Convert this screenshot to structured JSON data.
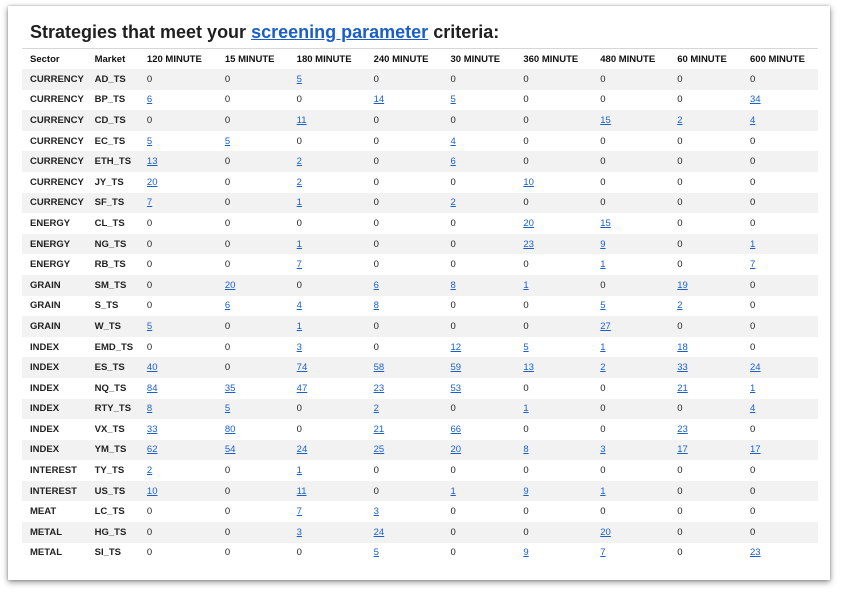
{
  "title": {
    "prefix": "Strategies that meet your",
    "link": "screening parameter",
    "suffix": "criteria:"
  },
  "columns": [
    "Sector",
    "Market",
    "120 MINUTE",
    "15 MINUTE",
    "180 MINUTE",
    "240 MINUTE",
    "30 MINUTE",
    "360 MINUTE",
    "480 MINUTE",
    "60 MINUTE",
    "600 MINUTE"
  ],
  "rows": [
    {
      "sector": "CURRENCY",
      "market": "AD_TS",
      "values": [
        "0",
        "0",
        "5",
        "0",
        "0",
        "0",
        "0",
        "0",
        "0"
      ]
    },
    {
      "sector": "CURRENCY",
      "market": "BP_TS",
      "values": [
        "6",
        "0",
        "0",
        "14",
        "5",
        "0",
        "0",
        "0",
        "34"
      ]
    },
    {
      "sector": "CURRENCY",
      "market": "CD_TS",
      "values": [
        "0",
        "0",
        "11",
        "0",
        "0",
        "0",
        "15",
        "2",
        "4"
      ]
    },
    {
      "sector": "CURRENCY",
      "market": "EC_TS",
      "values": [
        "5",
        "5",
        "0",
        "0",
        "4",
        "0",
        "0",
        "0",
        "0"
      ]
    },
    {
      "sector": "CURRENCY",
      "market": "ETH_TS",
      "values": [
        "13",
        "0",
        "2",
        "0",
        "6",
        "0",
        "0",
        "0",
        "0"
      ]
    },
    {
      "sector": "CURRENCY",
      "market": "JY_TS",
      "values": [
        "20",
        "0",
        "2",
        "0",
        "0",
        "10",
        "0",
        "0",
        "0"
      ]
    },
    {
      "sector": "CURRENCY",
      "market": "SF_TS",
      "values": [
        "7",
        "0",
        "1",
        "0",
        "2",
        "0",
        "0",
        "0",
        "0"
      ]
    },
    {
      "sector": "ENERGY",
      "market": "CL_TS",
      "values": [
        "0",
        "0",
        "0",
        "0",
        "0",
        "20",
        "15",
        "0",
        "0"
      ]
    },
    {
      "sector": "ENERGY",
      "market": "NG_TS",
      "values": [
        "0",
        "0",
        "1",
        "0",
        "0",
        "23",
        "9",
        "0",
        "1"
      ]
    },
    {
      "sector": "ENERGY",
      "market": "RB_TS",
      "values": [
        "0",
        "0",
        "7",
        "0",
        "0",
        "0",
        "1",
        "0",
        "7"
      ]
    },
    {
      "sector": "GRAIN",
      "market": "SM_TS",
      "values": [
        "0",
        "20",
        "0",
        "6",
        "8",
        "1",
        "0",
        "19",
        "0"
      ]
    },
    {
      "sector": "GRAIN",
      "market": "S_TS",
      "values": [
        "0",
        "6",
        "4",
        "8",
        "0",
        "0",
        "5",
        "2",
        "0"
      ]
    },
    {
      "sector": "GRAIN",
      "market": "W_TS",
      "values": [
        "5",
        "0",
        "1",
        "0",
        "0",
        "0",
        "27",
        "0",
        "0"
      ]
    },
    {
      "sector": "INDEX",
      "market": "EMD_TS",
      "values": [
        "0",
        "0",
        "3",
        "0",
        "12",
        "5",
        "1",
        "18",
        "0"
      ]
    },
    {
      "sector": "INDEX",
      "market": "ES_TS",
      "values": [
        "40",
        "0",
        "74",
        "58",
        "59",
        "13",
        "2",
        "33",
        "24"
      ]
    },
    {
      "sector": "INDEX",
      "market": "NQ_TS",
      "values": [
        "84",
        "35",
        "47",
        "23",
        "53",
        "0",
        "0",
        "21",
        "1"
      ]
    },
    {
      "sector": "INDEX",
      "market": "RTY_TS",
      "values": [
        "8",
        "5",
        "0",
        "2",
        "0",
        "1",
        "0",
        "0",
        "4"
      ]
    },
    {
      "sector": "INDEX",
      "market": "VX_TS",
      "values": [
        "33",
        "80",
        "0",
        "21",
        "66",
        "0",
        "0",
        "23",
        "0"
      ]
    },
    {
      "sector": "INDEX",
      "market": "YM_TS",
      "values": [
        "62",
        "54",
        "24",
        "25",
        "20",
        "8",
        "3",
        "17",
        "17"
      ]
    },
    {
      "sector": "INTEREST",
      "market": "TY_TS",
      "values": [
        "2",
        "0",
        "1",
        "0",
        "0",
        "0",
        "0",
        "0",
        "0"
      ]
    },
    {
      "sector": "INTEREST",
      "market": "US_TS",
      "values": [
        "10",
        "0",
        "11",
        "0",
        "1",
        "9",
        "1",
        "0",
        "0"
      ]
    },
    {
      "sector": "MEAT",
      "market": "LC_TS",
      "values": [
        "0",
        "0",
        "7",
        "3",
        "0",
        "0",
        "0",
        "0",
        "0"
      ]
    },
    {
      "sector": "METAL",
      "market": "HG_TS",
      "values": [
        "0",
        "0",
        "3",
        "24",
        "0",
        "0",
        "20",
        "0",
        "0"
      ]
    },
    {
      "sector": "METAL",
      "market": "SI_TS",
      "values": [
        "0",
        "0",
        "0",
        "5",
        "0",
        "9",
        "7",
        "0",
        "23"
      ]
    }
  ]
}
